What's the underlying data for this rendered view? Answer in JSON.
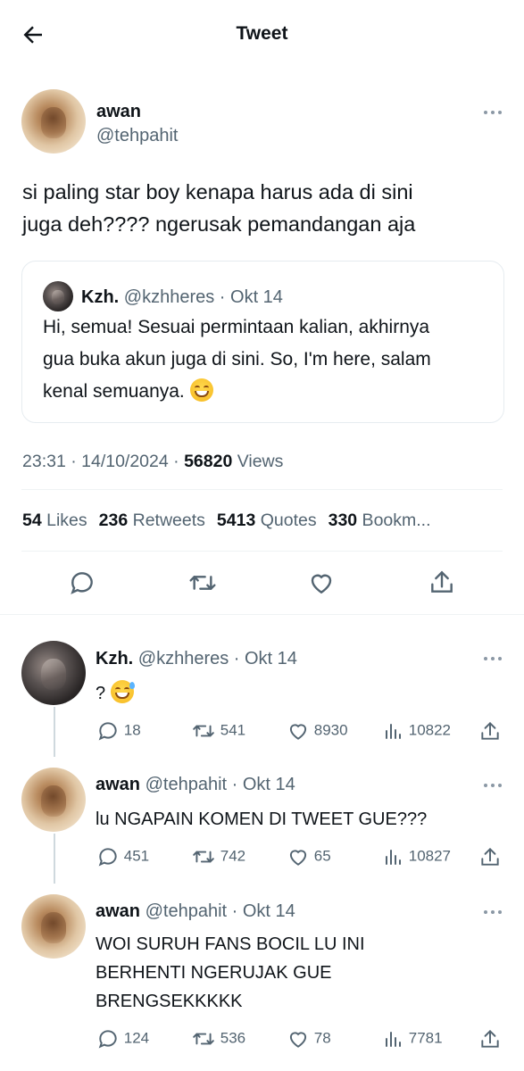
{
  "header": {
    "title": "Tweet"
  },
  "tweet": {
    "author_name": "awan",
    "author_handle": "@tehpahit",
    "text_line1": "si paling star boy kenapa harus ada di sini",
    "text_line2": "juga deh???? ngerusak pemandangan aja",
    "quote": {
      "name": "Kzh.",
      "handle_time": "@kzhheres · Okt 14",
      "line1": "Hi, semua! Sesuai permintaan kalian, akhirnya",
      "line2": "gua buka akun juga di sini. So, I'm here, salam",
      "line3": "kenal semuanya."
    },
    "meta": {
      "time_date": "23:31 · 14/10/2024 · ",
      "views_count": "56820",
      "views_label": " Views"
    },
    "stats": {
      "likes_count": "54",
      "likes_label": " Likes",
      "retweets_count": "236",
      "retweets_label": " Retweets",
      "quotes_count": "5413",
      "quotes_label": " Quotes",
      "bookmarks_count": "330",
      "bookmarks_label": " Bookm..."
    }
  },
  "replies": [
    {
      "name": "Kzh.",
      "handle_time": " @kzhheres · Okt 14",
      "text": "?",
      "replies": "18",
      "retweets": "541",
      "likes": "8930",
      "views": "10822"
    },
    {
      "name": "awan",
      "handle_time": " @tehpahit · Okt 14",
      "text": "lu NGAPAIN KOMEN DI TWEET GUE???",
      "replies": "451",
      "retweets": "742",
      "likes": "65",
      "views": "10827"
    },
    {
      "name": "awan",
      "handle_time": " @tehpahit · Okt 14",
      "text_line1": "WOI SURUH FANS BOCIL LU INI",
      "text_line2": "BERHENTI NGERUJAK GUE",
      "text_line3": "BRENGSEKKKKK",
      "replies": "124",
      "retweets": "536",
      "likes": "78",
      "views": "7781"
    }
  ],
  "icons": {
    "back": "arrow-left-icon",
    "more": "more-icon",
    "reply": "reply-icon",
    "retweet": "retweet-icon",
    "like": "heart-icon",
    "share": "share-icon",
    "views": "views-icon",
    "emoji_grin": "grinning-emoji",
    "emoji_sweat": "sweat-smile-emoji"
  },
  "colors": {
    "text": "#0f1419",
    "secondary": "#536471",
    "border": "#eff3f4"
  }
}
